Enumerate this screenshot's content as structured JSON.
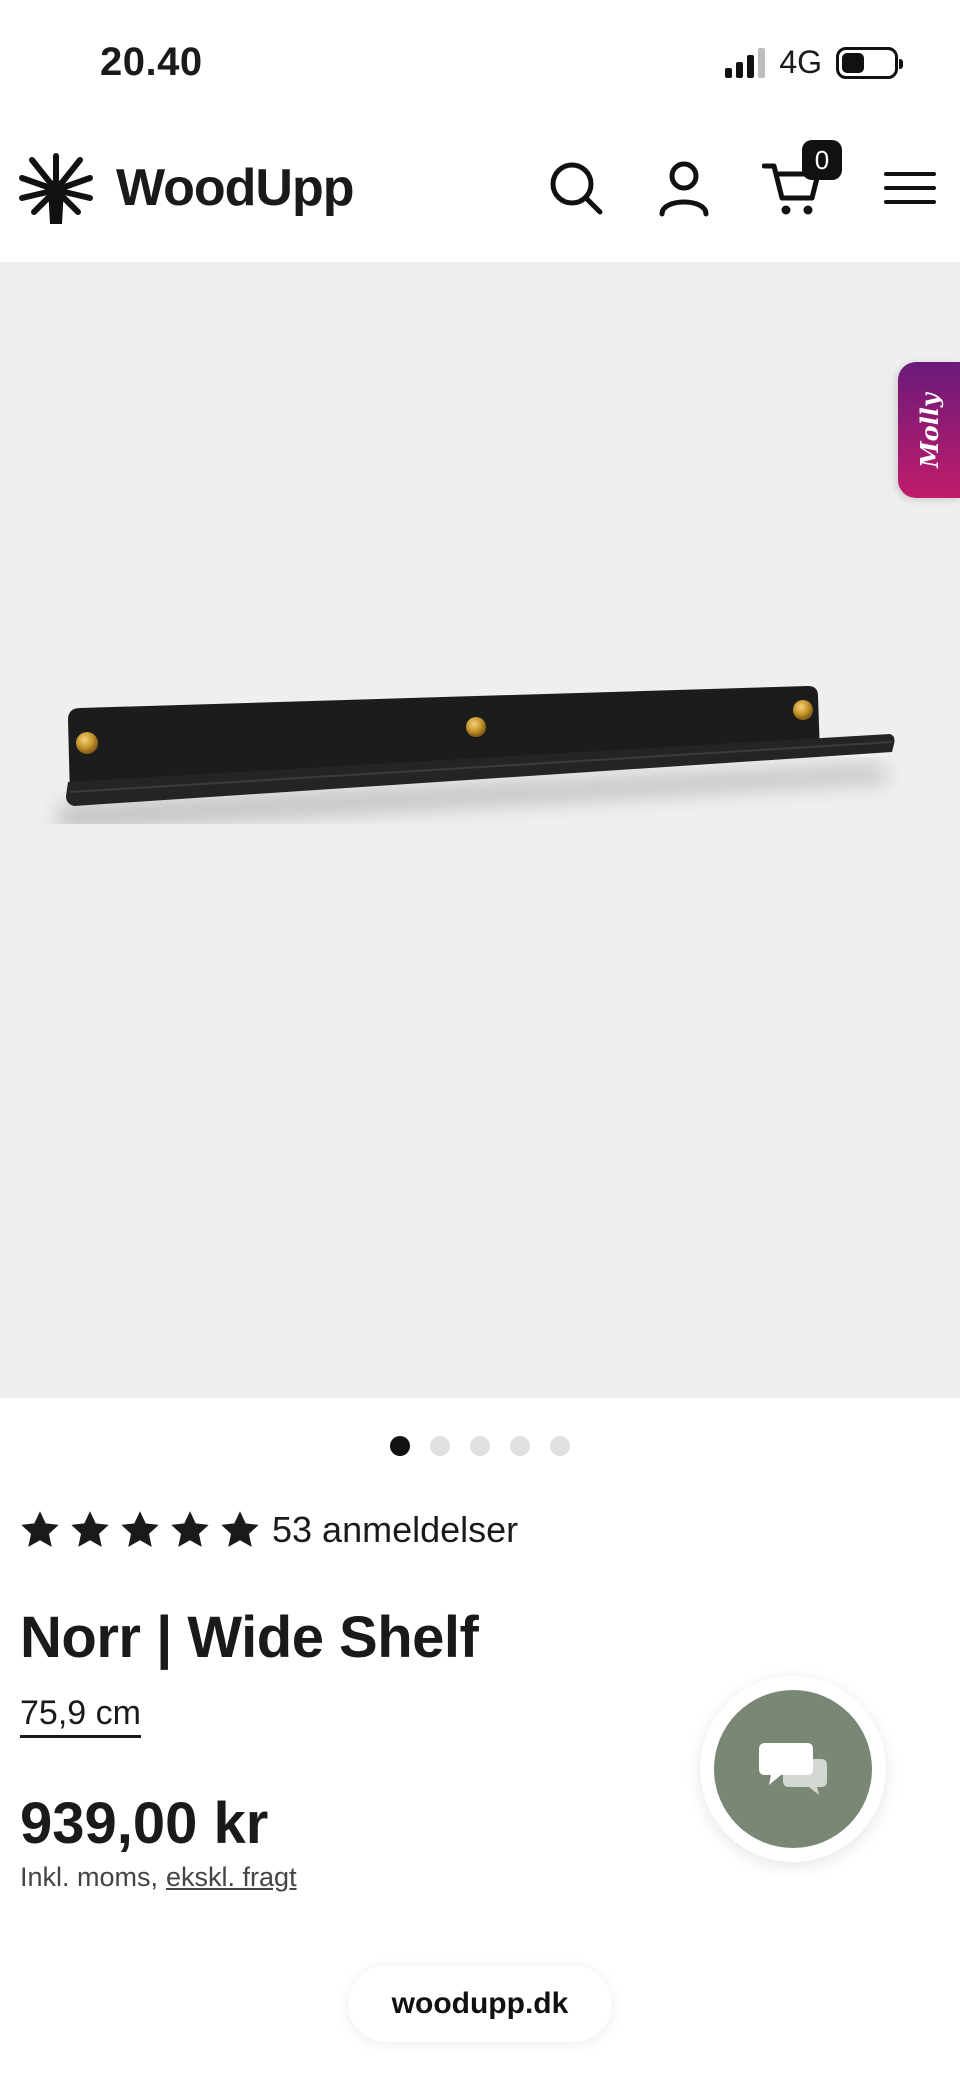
{
  "status_bar": {
    "time": "20.40",
    "network": "4G"
  },
  "header": {
    "brand": "WoodUpp",
    "cart_count": "0"
  },
  "hero": {
    "chat_tab_label": "Molly"
  },
  "gallery": {
    "total_images": 5,
    "active_index": 0
  },
  "product": {
    "rating_stars": 5,
    "reviews_label": "53 anmeldelser",
    "title": "Norr | Wide Shelf",
    "size": "75,9 cm",
    "price": "939,00 kr",
    "tax_note": "Inkl. moms,",
    "shipping_link": "ekskl. fragt"
  },
  "browser": {
    "url": "woodupp.dk"
  },
  "colors": {
    "hero_bg": "#efefef",
    "chat_button": "#7a8775",
    "molly_gradient_start": "#6b1a7a",
    "molly_gradient_end": "#c01c6a",
    "text": "#1a1a1a"
  },
  "icons": [
    "tree-logo-icon",
    "search-icon",
    "account-icon",
    "cart-icon",
    "menu-icon",
    "star-icon",
    "chat-icon"
  ]
}
